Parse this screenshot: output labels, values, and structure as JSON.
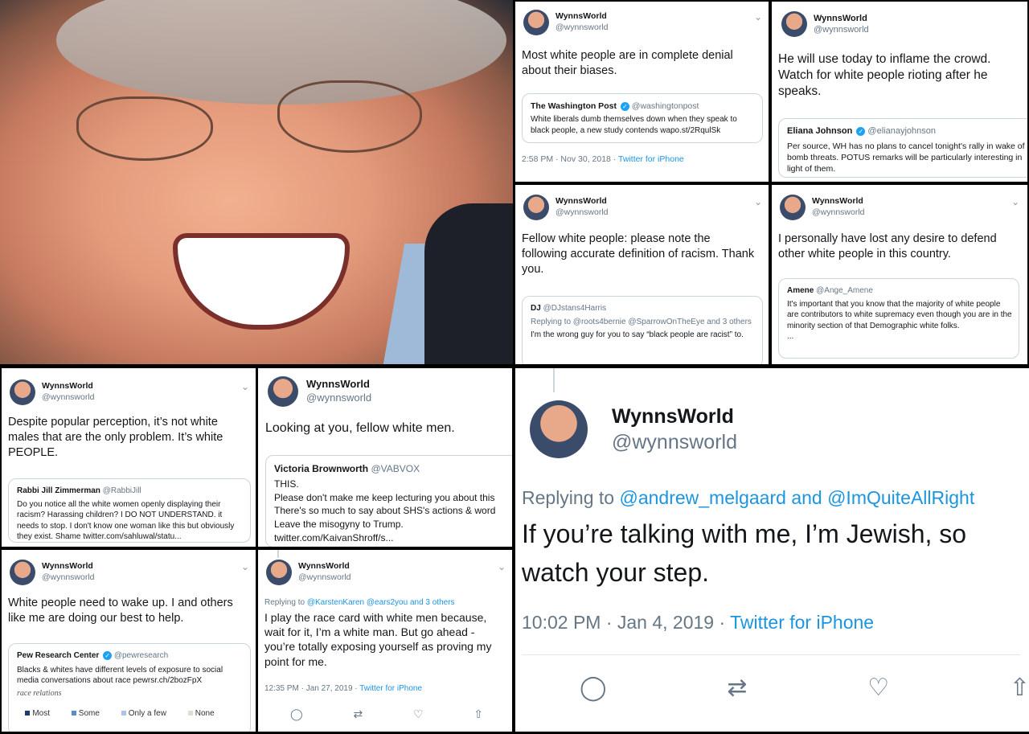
{
  "user": {
    "name": "WynnsWorld",
    "handle": "@wynnsworld"
  },
  "t1": {
    "text": "Most white people are in complete denial about their biases.",
    "quote": {
      "name": "The Washington Post",
      "handle": "@washingtonpost",
      "text": "White liberals dumb themselves down when they speak to black people, a new study contends wapo.st/2RqulSk"
    },
    "meta_time": "2:58 PM · Nov 30, 2018 · ",
    "meta_src": "Twitter for iPhone"
  },
  "t2": {
    "text": "He will use today to inflame the crowd. Watch for white people rioting after he speaks.",
    "quote": {
      "name": "Eliana Johnson",
      "handle": "@elianayjohnson",
      "text": "Per source, WH has no plans to cancel tonight's rally in wake of bomb threats. POTUS remarks will be particularly interesting in light of them."
    }
  },
  "t3": {
    "text": "Fellow white people: please note the following accurate definition of racism. Thank you.",
    "quote": {
      "name": "DJ",
      "handle": "@DJstans4Harris",
      "reply": "Replying to @roots4bernie @SparrowOnTheEye and 3 others",
      "text": "I'm the wrong guy for you to say “black people are racist” to."
    }
  },
  "t4": {
    "text": "I personally have lost any desire to defend other white people in this country.",
    "quote": {
      "name": "Amene",
      "handle": "@Ange_Amene",
      "text": "It's important that you know that the majority of white people are contributors to white supremacy even though you are in the minority section of that Demographic white folks.",
      "more": "..."
    }
  },
  "t5": {
    "text": "Despite popular perception, it’s not white males that are the only problem. It’s white PEOPLE.",
    "quote": {
      "name": "Rabbi Jill Zimmerman",
      "handle": "@RabbiJill",
      "text": "Do you notice all the white women openly displaying their racism? Harassing children? I DO NOT UNDERSTAND. it needs to stop. I don't know one woman like this but obviously they exist. Shame twitter.com/sahluwal/statu..."
    }
  },
  "t6": {
    "text": "Looking at you, fellow white men.",
    "quote": {
      "name": "Victoria Brownworth",
      "handle": "@VABVOX",
      "l1": "THIS.",
      "l2": "Please don't make me keep lecturing you about this",
      "l3": "There's so much to say about SHS's actions & word",
      "l4": "Leave the misogyny to Trump.",
      "l5": "twitter.com/KaivanShroff/s..."
    }
  },
  "t7": {
    "text": "White people need to wake up. I and others like me are doing our best to help.",
    "quote": {
      "name": "Pew Research Center",
      "handle": "@pewresearch",
      "text": "Blacks & whites have different levels of exposure to social media conversations about race pewrsr.ch/2bozFpX",
      "img_caption": "race relations",
      "legend": [
        "Most",
        "Some",
        "Only a few",
        "None"
      ]
    }
  },
  "t8": {
    "reply_prefix": "Replying to ",
    "reply_to": "@KarstenKaren @ears2you and 3 others",
    "text": "I play the race card with white men because, wait for it, I’m a white man. But go ahead - you’re totally exposing yourself as proving my point for me.",
    "meta_time": "12:35 PM · Jan 27, 2019 · ",
    "meta_src": "Twitter for iPhone"
  },
  "t9": {
    "reply_prefix": "Replying to ",
    "reply_to": "@andrew_melgaard and @ImQuiteAllRight",
    "text": "If you’re talking with me, I’m Jewish, so watch your step.",
    "meta_time": "10:02 PM · Jan 4, 2019 · ",
    "meta_src": "Twitter for iPhone"
  },
  "icons": {
    "reply": "reply-icon",
    "retweet": "retweet-icon",
    "like": "heart-icon",
    "share": "share-icon",
    "chevron": "chevron-down-icon"
  },
  "colors": {
    "link": "#1b95e0",
    "secondary": "#657786",
    "verified": "#1da1f2",
    "border": "#ccd6dd"
  }
}
